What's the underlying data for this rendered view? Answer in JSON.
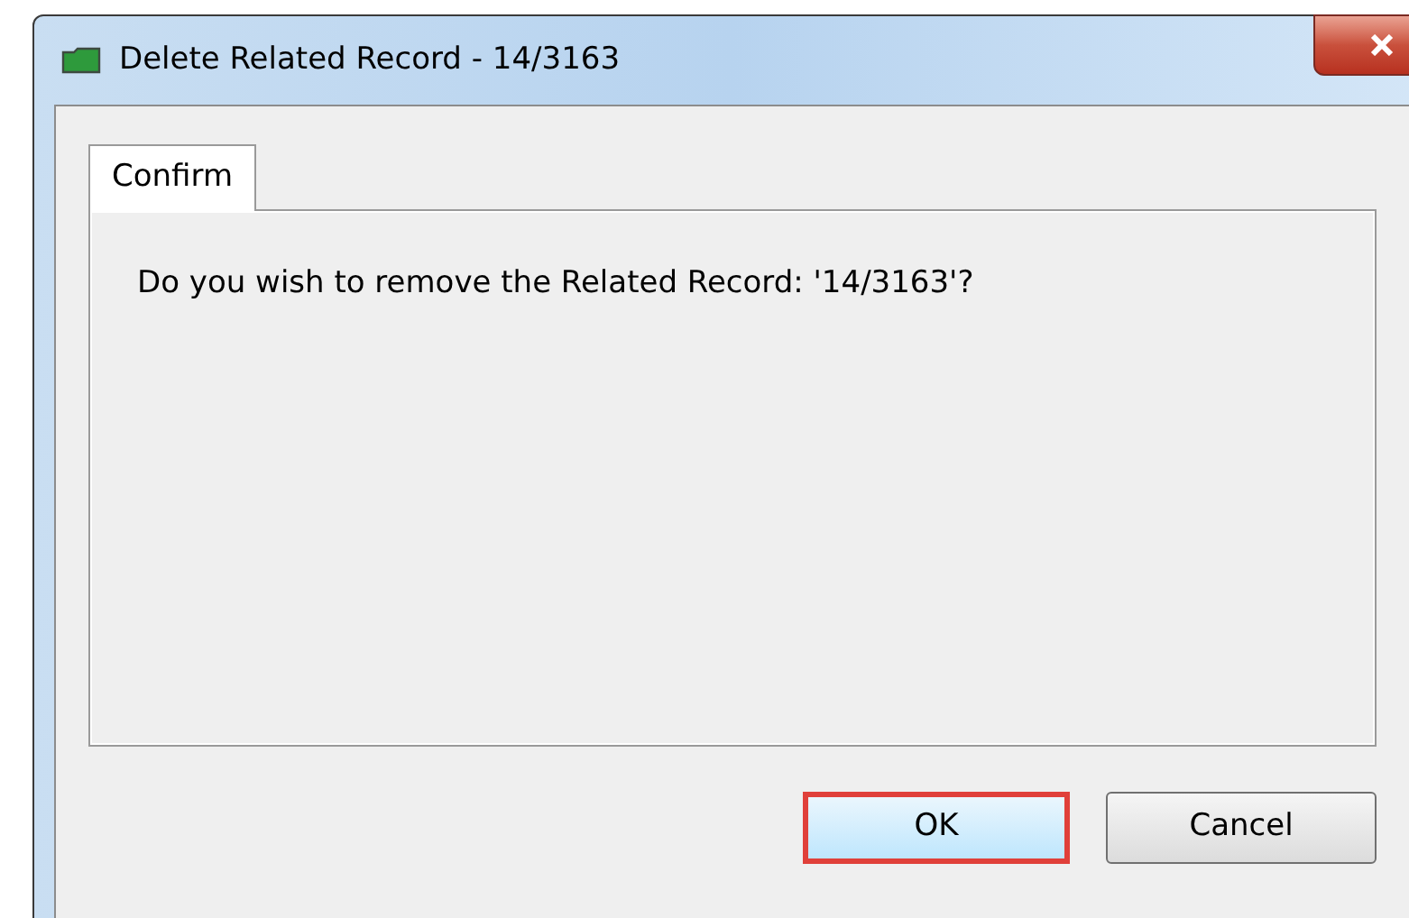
{
  "window": {
    "title": "Delete Related Record - 14/3163"
  },
  "tabs": [
    {
      "label": "Confirm",
      "selected": true
    }
  ],
  "message": "Do you wish to remove the Related Record: '14/3163'?",
  "buttons": [
    {
      "label": "OK",
      "highlighted": true
    },
    {
      "label": "Cancel",
      "highlighted": false
    }
  ]
}
